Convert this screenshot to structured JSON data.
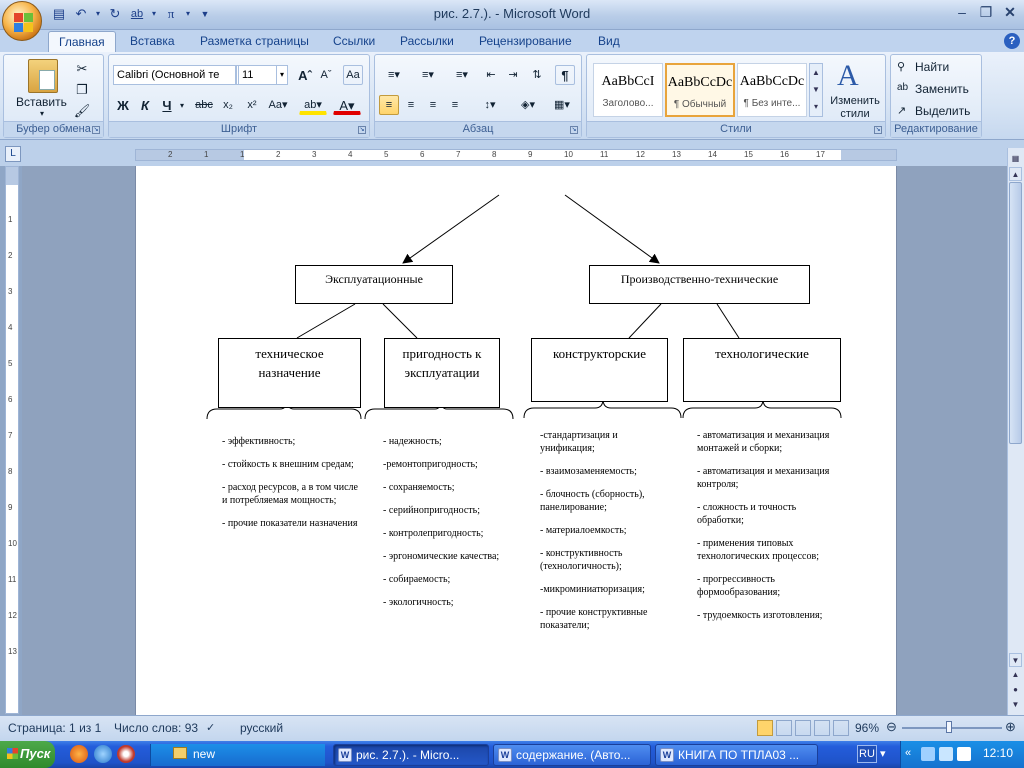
{
  "window": {
    "title": "рис. 2.7.). - Microsoft Word"
  },
  "qat": {
    "save_icon": "save-icon",
    "undo_icon": "undo-icon",
    "redo_icon": "redo-icon",
    "spell_icon": "spelling-icon",
    "pi_icon": "pi-icon"
  },
  "tabs": [
    "Главная",
    "Вставка",
    "Разметка страницы",
    "Ссылки",
    "Рассылки",
    "Рецензирование",
    "Вид"
  ],
  "ribbon": {
    "clipboard": {
      "label": "Буфер обмена",
      "paste": "Вставить"
    },
    "font": {
      "label": "Шрифт",
      "name": "Calibri (Основной те",
      "size": "11"
    },
    "paragraph": {
      "label": "Абзац"
    },
    "styles": {
      "label": "Стили",
      "items": [
        {
          "preview": "AaBbCcI",
          "name": "Заголово..."
        },
        {
          "preview": "AaBbCcDc",
          "name": "¶ Обычный"
        },
        {
          "preview": "AaBbCcDc",
          "name": "¶ Без инте..."
        }
      ],
      "change": "Изменить стили"
    },
    "editing": {
      "label": "Редактирование",
      "find": "Найти",
      "replace": "Заменить",
      "select": "Выделить"
    }
  },
  "ruler": {
    "numbers": [
      "2",
      "1",
      "1",
      "2",
      "3",
      "4",
      "5",
      "6",
      "7",
      "8",
      "9",
      "10",
      "11",
      "12",
      "13",
      "14",
      "15",
      "16",
      "17"
    ],
    "vnumbers": [
      "1",
      "2",
      "3",
      "4",
      "5",
      "6",
      "7",
      "8",
      "9",
      "10",
      "11",
      "12",
      "13"
    ]
  },
  "document": {
    "top_boxes": [
      {
        "label": "Эксплуатационные"
      },
      {
        "label": "Производственно-технические"
      }
    ],
    "sub_boxes": [
      {
        "label": "техническое назначение"
      },
      {
        "label": "пригодность к эксплуатации"
      },
      {
        "label": "конструкторские"
      },
      {
        "label": "технологические"
      }
    ],
    "lists": [
      [
        "- эффективность;",
        "- стойкость к внешним средам;",
        "- расход ресурсов, а в том числе и потребляемая мощность;",
        "- прочие показатели назначения"
      ],
      [
        "- надежность;",
        "-ремонтопригодность;",
        "- сохраняемость;",
        "- серийнопригодность;",
        "- контролепригодность;",
        "- эргономические качества;",
        "- собираемость;",
        "- экологичность;"
      ],
      [
        "-стандартизация и унификация;",
        "- взаимозаменяемость;",
        "- блочность (сборность), панелирование;",
        "- материалоемкость;",
        "- конструктивность (технологичность);",
        "-микроминиатюризация;",
        "- прочие конструктивные показатели;"
      ],
      [
        "- автоматизация и механизация монтажей и сборки;",
        "- автоматизация и механизация контроля;",
        "- сложность и точность обработки;",
        "- применения типовых технологических процессов;",
        "- прогрессивность формообразования;",
        "- трудоемкость изготовления;"
      ]
    ]
  },
  "status": {
    "page": "Страница: 1 из 1",
    "words": "Число слов: 93",
    "lang": "русский",
    "zoom": "96%"
  },
  "taskbar": {
    "start": "Пуск",
    "folder": "new",
    "buttons": [
      "рис. 2.7.). - Micro...",
      "содержание. (Авто...",
      "КНИГА ПО ТПЛА03 ..."
    ],
    "lang": "RU",
    "clock": "12:10"
  },
  "colors": {
    "accent": "#15428b",
    "ribbon": "#d7e4f4",
    "taskbar": "#245ddb"
  }
}
